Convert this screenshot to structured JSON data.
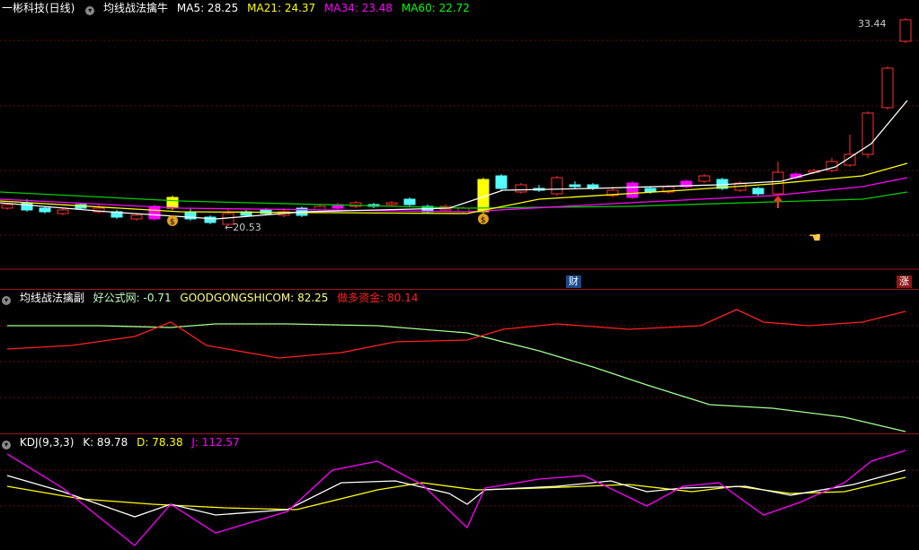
{
  "main": {
    "stock": "一彬科技(日线)",
    "indicator": "均线战法擒牛",
    "ma": [
      {
        "label": "MA5: 28.25",
        "color": "#ffffff"
      },
      {
        "label": "MA21: 24.37",
        "color": "#ffff00"
      },
      {
        "label": "MA34: 23.48",
        "color": "#ff00ff"
      },
      {
        "label": "MA60: 22.72",
        "color": "#00ff00"
      }
    ],
    "high_label": "33.44",
    "low_label": "←20.53",
    "badge_cai": "财",
    "badge_zhang": "涨",
    "coin_icon": "$"
  },
  "sub1": {
    "title": "均线战法擒副",
    "items": [
      {
        "label": "好公式网: -0.71",
        "color": "#c0ffc0"
      },
      {
        "label": "GOODGONGSHICOM: 82.25",
        "color": "#ffff80"
      },
      {
        "label": "做多资金: 80.14",
        "color": "#ff2020"
      }
    ]
  },
  "sub2": {
    "title": "KDJ(9,3,3)",
    "items": [
      {
        "label": "K: 89.78",
        "color": "#ffffff"
      },
      {
        "label": "D: 78.38",
        "color": "#ffff00"
      },
      {
        "label": "J: 112.57",
        "color": "#ff00ff"
      }
    ]
  },
  "colors": {
    "up": "#ff3030",
    "down": "#54ffff",
    "grid": "#7a1010",
    "sep": "#a0141e"
  }
}
